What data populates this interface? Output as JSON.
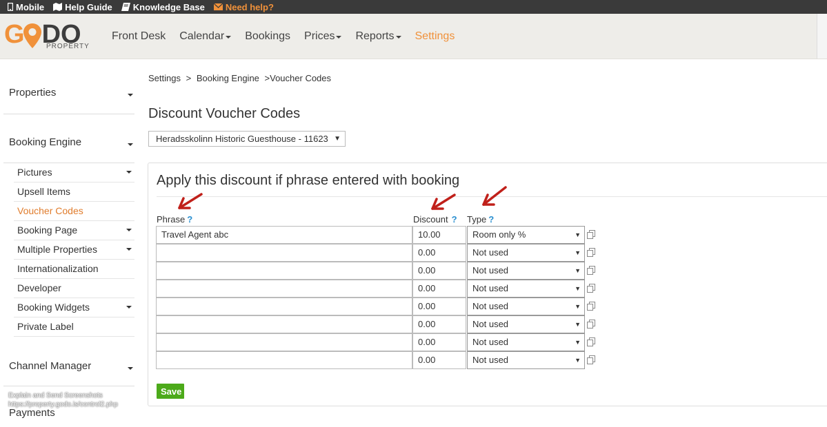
{
  "topbar": {
    "mobile": "Mobile",
    "help_guide": "Help Guide",
    "knowledge_base": "Knowledge Base",
    "need_help": "Need help?"
  },
  "logo": {
    "word_g": "G",
    "word_rest": "DO",
    "sub": "PROPERTY"
  },
  "nav": {
    "items": [
      {
        "label": "Front Desk",
        "dropdown": false
      },
      {
        "label": "Calendar",
        "dropdown": true
      },
      {
        "label": "Bookings",
        "dropdown": false
      },
      {
        "label": "Prices",
        "dropdown": true
      },
      {
        "label": "Reports",
        "dropdown": true
      },
      {
        "label": "Settings",
        "dropdown": false,
        "active": true
      }
    ]
  },
  "sidebar": {
    "sections": [
      "Properties",
      "Booking Engine",
      "Channel Manager",
      "Payments"
    ],
    "sub_items": [
      {
        "label": "Pictures",
        "dropdown": true
      },
      {
        "label": "Upsell Items",
        "dropdown": false
      },
      {
        "label": "Voucher Codes",
        "dropdown": false,
        "active": true
      },
      {
        "label": "Booking Page",
        "dropdown": true
      },
      {
        "label": "Multiple Properties",
        "dropdown": true
      },
      {
        "label": "Internationalization",
        "dropdown": false
      },
      {
        "label": "Developer",
        "dropdown": false
      },
      {
        "label": "Booking Widgets",
        "dropdown": true
      },
      {
        "label": "Private Label",
        "dropdown": false
      }
    ]
  },
  "watermark": {
    "line1": "Explain and Send Screenshots",
    "line2": "https://property.godo.is/control2.php"
  },
  "breadcrumb": {
    "a": "Settings",
    "sep1": ">",
    "b": "Booking Engine",
    "sep2": ">",
    "c": "Voucher Codes"
  },
  "page_title": "Discount Voucher Codes",
  "property_select": {
    "value": "Heradsskolinn Historic Guesthouse - 11623"
  },
  "panel": {
    "title": "Apply this discount if phrase entered with booking",
    "col_phrase": "Phrase",
    "col_discount": "Discount",
    "col_type": "Type",
    "help": "?",
    "rows": [
      {
        "phrase": "Travel Agent abc",
        "discount": "10.00",
        "type": "Room only %"
      },
      {
        "phrase": "",
        "discount": "0.00",
        "type": "Not used"
      },
      {
        "phrase": "",
        "discount": "0.00",
        "type": "Not used"
      },
      {
        "phrase": "",
        "discount": "0.00",
        "type": "Not used"
      },
      {
        "phrase": "",
        "discount": "0.00",
        "type": "Not used"
      },
      {
        "phrase": "",
        "discount": "0.00",
        "type": "Not used"
      },
      {
        "phrase": "",
        "discount": "0.00",
        "type": "Not used"
      },
      {
        "phrase": "",
        "discount": "0.00",
        "type": "Not used"
      }
    ],
    "save_label": "Save"
  },
  "colors": {
    "accent": "#f0913a",
    "save": "#4caa1a",
    "help": "#2a8fd0",
    "annotation_arrow": "#c0201a"
  }
}
